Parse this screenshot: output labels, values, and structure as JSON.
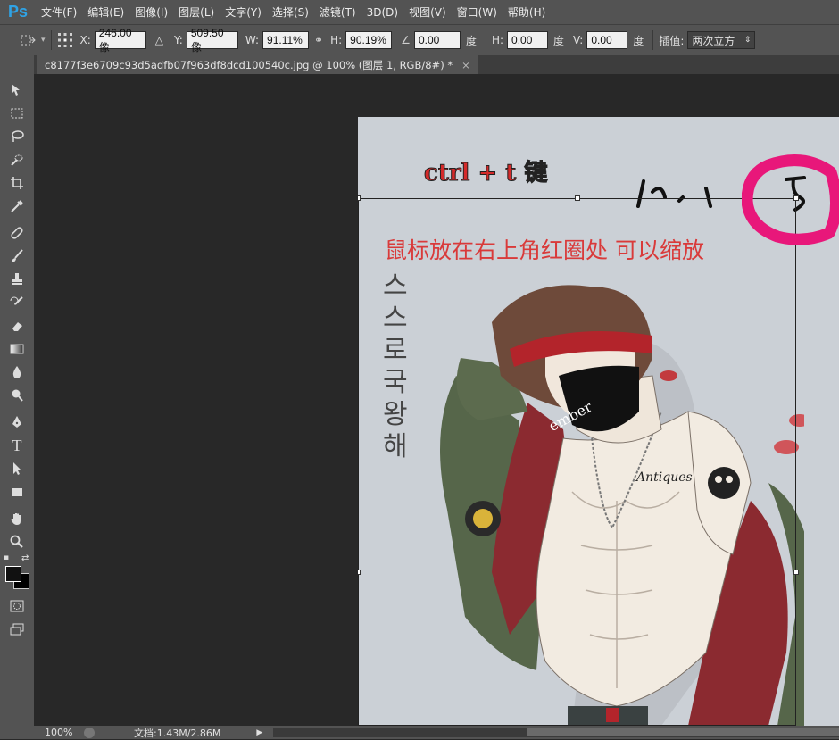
{
  "app": {
    "logo": "Ps"
  },
  "menu": [
    "文件(F)",
    "编辑(E)",
    "图像(I)",
    "图层(L)",
    "文字(Y)",
    "选择(S)",
    "滤镜(T)",
    "3D(D)",
    "视图(V)",
    "窗口(W)",
    "帮助(H)"
  ],
  "options": {
    "x_label": "X:",
    "x_value": "246.00 像",
    "y_label": "Y:",
    "y_value": "509.50 像",
    "w_label": "W:",
    "w_value": "91.11%",
    "h_label": "H:",
    "h_value": "90.19%",
    "angle_value": "0.00",
    "angle_unit": "度",
    "hskew_label": "H:",
    "hskew_value": "0.00",
    "hskew_unit": "度",
    "vskew_label": "V:",
    "vskew_value": "0.00",
    "vskew_unit": "度",
    "interp_label": "插值:",
    "interp_value": "两次立方"
  },
  "document": {
    "tab_title": "c8177f3e6709c93d5adfb07f963df8dcd100540c.jpg @ 100% (图层 1, RGB/8#) *",
    "close": "×"
  },
  "canvas_text": {
    "ctrl_hint": "ctrl + t 键",
    "note": "鼠标放在右上角红圈处  可以缩放",
    "korean": [
      "스",
      "스",
      "로",
      "국",
      "왕",
      "해"
    ],
    "mask_text": "ember",
    "tattoo_text": "Antiques"
  },
  "status": {
    "zoom": "100%",
    "doc_info": "文档:1.43M/2.86M"
  },
  "colors": {
    "annotation_red": "#d93a3a",
    "circle_magenta": "#e8177a",
    "ps_blue": "#2fa3e6"
  }
}
